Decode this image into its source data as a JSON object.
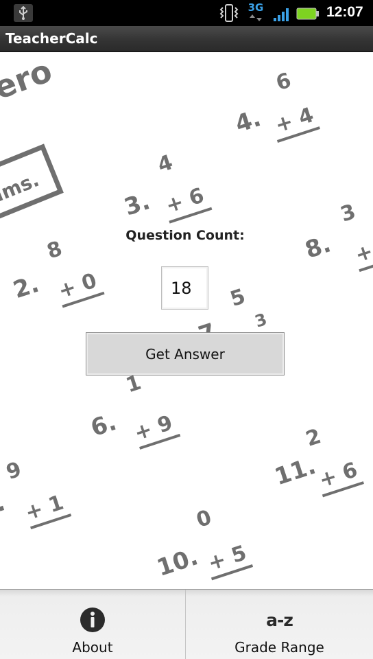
{
  "status_bar": {
    "network_label": "3G",
    "time": "12:07",
    "icons": [
      "usb-icon",
      "vibrate-icon",
      "network-3g-icon",
      "signal-icon",
      "battery-icon"
    ]
  },
  "app": {
    "title": "TeacherCalc"
  },
  "form": {
    "question_count_label": "Question Count:",
    "question_count_value": "18",
    "get_answer_label": "Get Answer"
  },
  "menu": {
    "items": [
      {
        "label": "About",
        "icon": "info-icon"
      },
      {
        "label": "Grade Range",
        "icon": "a-z-icon",
        "glyph": "a-z"
      }
    ]
  },
  "colors": {
    "status_bar": "#000000",
    "title_bar": "#333333",
    "button_bg": "#d8d8d8",
    "network_blue": "#3aa0e6",
    "battery_green": "#7ed321",
    "worksheet_text": "#6f6f6f"
  }
}
